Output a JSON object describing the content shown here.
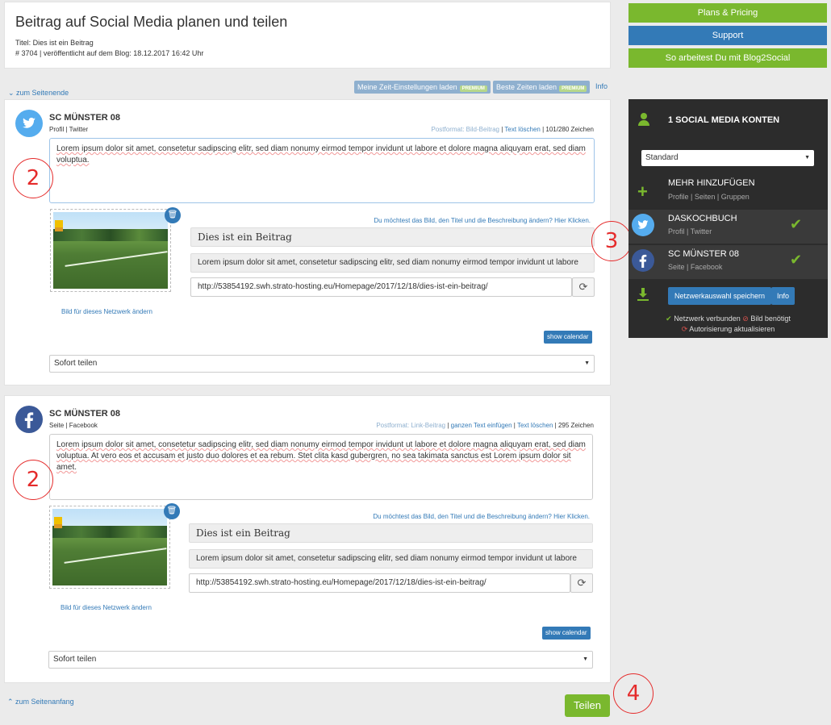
{
  "header": {
    "title": "Beitrag auf Social Media planen und teilen",
    "post_title": "Titel: Dies ist ein Beitrag",
    "post_meta": "# 3704 | veröffentlicht auf dem Blog: 18.12.2017 16:42 Uhr"
  },
  "toolbar": {
    "jump_end": "zum Seitenende",
    "load_time_settings": "Meine Zeit-Einstellungen laden",
    "best_times": "Beste Zeiten laden",
    "premium": "PREMIUM",
    "info": "Info"
  },
  "networks": [
    {
      "name": "SC MÜNSTER 08",
      "sub": "Profil | Twitter",
      "format": "Postformat: Bild-Beitrag",
      "insert_text": "",
      "clear_text": "Text löschen",
      "char_count": "101/280 Zeichen",
      "text": "Lorem ipsum dolor sit amet, consetetur sadipscing elitr, sed diam nonumy eirmod tempor invidunt ut labore et dolore magna aliquyam erat, sed diam voluptua.",
      "hint": "Du möchtest das Bild, den Titel und die Beschreibung ändern? Hier Klicken.",
      "og_title": "Dies ist ein Beitrag",
      "og_desc": "Lorem ipsum dolor sit amet, consetetur sadipscing elitr, sed diam nonumy eirmod tempor invidunt ut labore",
      "url": "http://53854192.swh.strato-hosting.eu/Homepage/2017/12/18/dies-ist-ein-beitrag/",
      "change_image": "Bild für dieses Netzwerk ändern",
      "show_calendar": "show calendar",
      "share_mode": "Sofort teilen"
    },
    {
      "name": "SC MÜNSTER 08",
      "sub": "Seite | Facebook",
      "format": "Postformat: Link-Beitrag",
      "insert_text": "ganzen Text einfügen",
      "clear_text": "Text löschen",
      "char_count": "295 Zeichen",
      "text": "Lorem ipsum dolor sit amet, consetetur sadipscing elitr, sed diam nonumy eirmod tempor invidunt ut labore et dolore magna aliquyam erat, sed diam voluptua. At vero eos et accusam et justo duo dolores et ea rebum. Stet clita kasd gubergren, no sea takimata sanctus est Lorem ipsum dolor sit amet.",
      "hint": "Du möchtest das Bild, den Titel und die Beschreibung ändern? Hier Klicken.",
      "og_title": "Dies ist ein Beitrag",
      "og_desc": "Lorem ipsum dolor sit amet, consetetur sadipscing elitr, sed diam nonumy eirmod tempor invidunt ut labore",
      "url": "http://53854192.swh.strato-hosting.eu/Homepage/2017/12/18/dies-ist-ein-beitrag/",
      "change_image": "Bild für dieses Netzwerk ändern",
      "show_calendar": "show calendar",
      "share_mode": "Sofort teilen"
    }
  ],
  "footer": {
    "jump_top": "zum Seitenanfang",
    "share_button": "Teilen"
  },
  "annotations": [
    "2",
    "3",
    "2",
    "4"
  ],
  "sidebar": {
    "plans": "Plans & Pricing",
    "support": "Support",
    "howto": "So arbeitest Du mit Blog2Social",
    "accounts_title": "1 SOCIAL MEDIA KONTEN",
    "profile_select": "Standard",
    "add_more": "MEHR HINZUFÜGEN",
    "add_more_sub": "Profile | Seiten | Gruppen",
    "accounts": [
      {
        "name": "DASKOCHBUCH",
        "sub": "Profil | Twitter"
      },
      {
        "name": "SC MÜNSTER 08",
        "sub": "Seite | Facebook"
      }
    ],
    "save_selection": "Netzwerkauswahl speichern",
    "info": "Info",
    "legend_connected": "Netzwerk verbunden",
    "legend_image": "Bild benötigt",
    "legend_reauth": "Autorisierung aktualisieren"
  },
  "colors": {
    "green": "#7ab82e",
    "blue": "#337ab7",
    "dark_panel": "#2c2c2c",
    "annotation_red": "#e52b2b"
  }
}
